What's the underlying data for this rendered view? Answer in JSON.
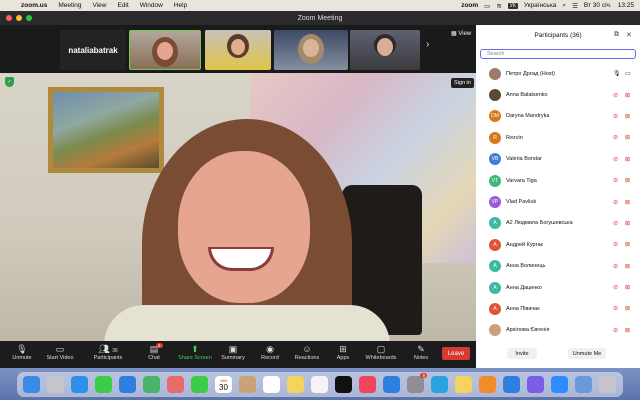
{
  "menubar": {
    "app": "zoom.us",
    "items": [
      "Meeting",
      "View",
      "Edit",
      "Window",
      "Help"
    ],
    "right": {
      "zoom": "zoom",
      "kb": "УК",
      "lang": "Українська",
      "date": "Вт 30 січ.",
      "time": "13:25"
    }
  },
  "window": {
    "title": "Zoom Meeting"
  },
  "gallery": {
    "name_tile": "nataliabatrak",
    "view": "View",
    "sign_in": "Sign in"
  },
  "toolbar": {
    "unmute": "Unmute",
    "start_video": "Start Video",
    "participants": "Participants",
    "participants_count": "36",
    "chat": "Chat",
    "chat_badge": "2",
    "share": "Share Screen",
    "summary": "Summary",
    "record": "Record",
    "reactions": "Reactions",
    "apps": "Apps",
    "whiteboards": "Whiteboards",
    "notes": "Notes",
    "leave": "Leave"
  },
  "panel": {
    "title": "Participants (36)",
    "search_placeholder": "Search",
    "participants": [
      {
        "name": "Петро Дрозд (Host)",
        "initials": "",
        "color": "#9b7b6b",
        "mic": "on",
        "cam": "on"
      },
      {
        "name": "Anna Balatsenko",
        "initials": "",
        "color": "#5a4a3a",
        "mic": "off",
        "cam": "off"
      },
      {
        "name": "Daryna Mandryka",
        "initials": "DM",
        "color": "#d9771e",
        "mic": "off",
        "cam": "off"
      },
      {
        "name": "Rezvin",
        "initials": "R",
        "color": "#d9771e",
        "mic": "off",
        "cam": "off"
      },
      {
        "name": "Valeria Bondar",
        "initials": "VB",
        "color": "#3f7fd6",
        "mic": "off",
        "cam": "off"
      },
      {
        "name": "Varvara  Tiga",
        "initials": "VT",
        "color": "#3db87a",
        "mic": "off",
        "cam": "off"
      },
      {
        "name": "Vlad Pavliuk",
        "initials": "VP",
        "color": "#9a5bd6",
        "mic": "off",
        "cam": "off"
      },
      {
        "name": "А2 Людмила Богушевська",
        "initials": "A",
        "color": "#3db8a3",
        "mic": "off",
        "cam": "off"
      },
      {
        "name": "Андрей Кургак",
        "initials": "A",
        "color": "#e0533a",
        "mic": "off",
        "cam": "off"
      },
      {
        "name": "Анна Волинець",
        "initials": "A",
        "color": "#3db8a3",
        "mic": "off",
        "cam": "off"
      },
      {
        "name": "Анна Даценко",
        "initials": "A",
        "color": "#3db8a3",
        "mic": "off",
        "cam": "off"
      },
      {
        "name": "Анна Півачак",
        "initials": "A",
        "color": "#e0533a",
        "mic": "off",
        "cam": "off"
      },
      {
        "name": "Архілова Євгенія",
        "initials": "",
        "color": "#c8a27c",
        "mic": "off",
        "cam": "off"
      }
    ],
    "invite": "Invite",
    "unmute_me": "Unmute Me"
  },
  "dock": {
    "calendar_day": "30",
    "calendar_month": "JAN",
    "badge": "9",
    "apps": [
      "finder",
      "launchpad",
      "safari",
      "messages",
      "mail",
      "maps",
      "photos",
      "facetime",
      "calendar",
      "contacts",
      "reminders",
      "notes",
      "freeform",
      "tv",
      "music",
      "app-store",
      "system-settings",
      "telegram",
      "notes2",
      "books",
      "bluetooth",
      "viber",
      "zoom",
      "preview",
      "trash"
    ]
  }
}
